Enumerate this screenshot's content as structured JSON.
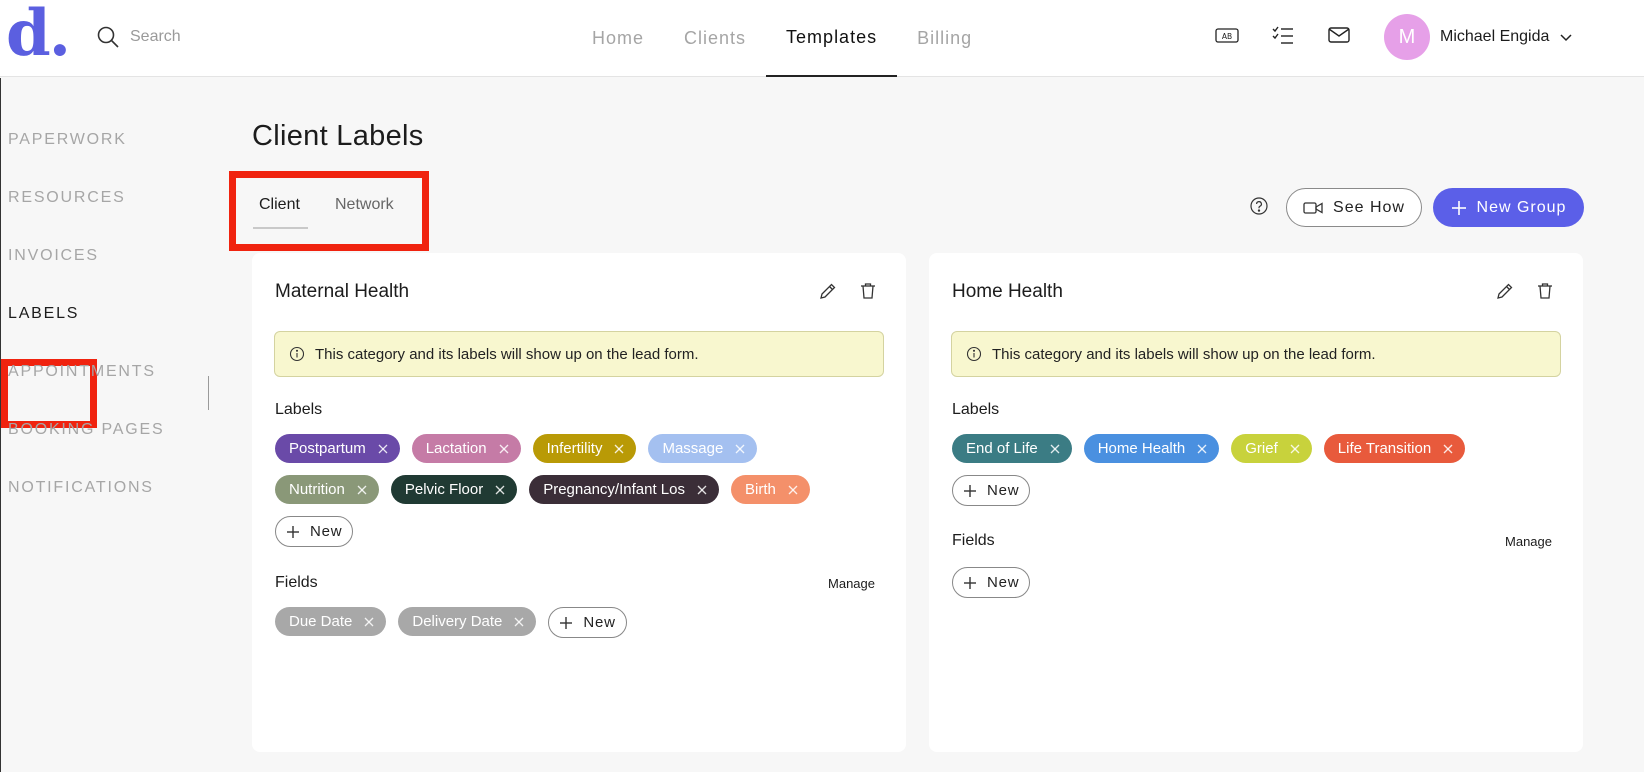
{
  "header": {
    "logo": "d.",
    "search_placeholder": "Search",
    "nav": [
      {
        "label": "Home",
        "active": false
      },
      {
        "label": "Clients",
        "active": false
      },
      {
        "label": "Templates",
        "active": true
      },
      {
        "label": "Billing",
        "active": false
      }
    ],
    "user": {
      "initial": "M",
      "name": "Michael Engida"
    }
  },
  "sidebar": {
    "items": [
      {
        "label": "PAPERWORK"
      },
      {
        "label": "RESOURCES"
      },
      {
        "label": "INVOICES"
      },
      {
        "label": "LABELS"
      },
      {
        "label": "APPOINTMENTS"
      },
      {
        "label": "BOOKING PAGES"
      },
      {
        "label": "NOTIFICATIONS"
      }
    ],
    "active_index": 3
  },
  "main": {
    "title": "Client Labels",
    "tabs": [
      {
        "label": "Client"
      },
      {
        "label": "Network"
      }
    ],
    "see_how_label": "See How",
    "new_group_label": "New Group"
  },
  "cards": [
    {
      "title": "Maternal Health",
      "notice": "This category and its labels will show up on the lead form.",
      "labels_heading": "Labels",
      "labels": [
        {
          "text": "Postpartum",
          "color": "#6a4aa8"
        },
        {
          "text": "Lactation",
          "color": "#c57ba6"
        },
        {
          "text": "Infertility",
          "color": "#b99a06"
        },
        {
          "text": "Massage",
          "color": "#a4c0f0"
        },
        {
          "text": "Nutrition",
          "color": "#8a9878"
        },
        {
          "text": "Pelvic Floor",
          "color": "#203a33"
        },
        {
          "text": "Pregnancy/Infant Los",
          "color": "#3b2e38"
        },
        {
          "text": "Birth",
          "color": "#f4906a"
        }
      ],
      "new_label": "New",
      "fields_heading": "Fields",
      "manage_label": "Manage",
      "fields": [
        {
          "text": "Due Date",
          "color": "#a8a8a8"
        },
        {
          "text": "Delivery Date",
          "color": "#a8a8a8"
        }
      ]
    },
    {
      "title": "Home Health",
      "notice": "This category and its labels will show up on the lead form.",
      "labels_heading": "Labels",
      "labels": [
        {
          "text": "End of Life",
          "color": "#3b7c84"
        },
        {
          "text": "Home Health",
          "color": "#4a90e0"
        },
        {
          "text": "Grief",
          "color": "#c8d23c"
        },
        {
          "text": "Life Transition",
          "color": "#e85a3c"
        }
      ],
      "new_label": "New",
      "fields_heading": "Fields",
      "manage_label": "Manage",
      "fields": []
    }
  ],
  "colors": {
    "accent": "#5b5fe8",
    "highlight": "#f0230f"
  }
}
